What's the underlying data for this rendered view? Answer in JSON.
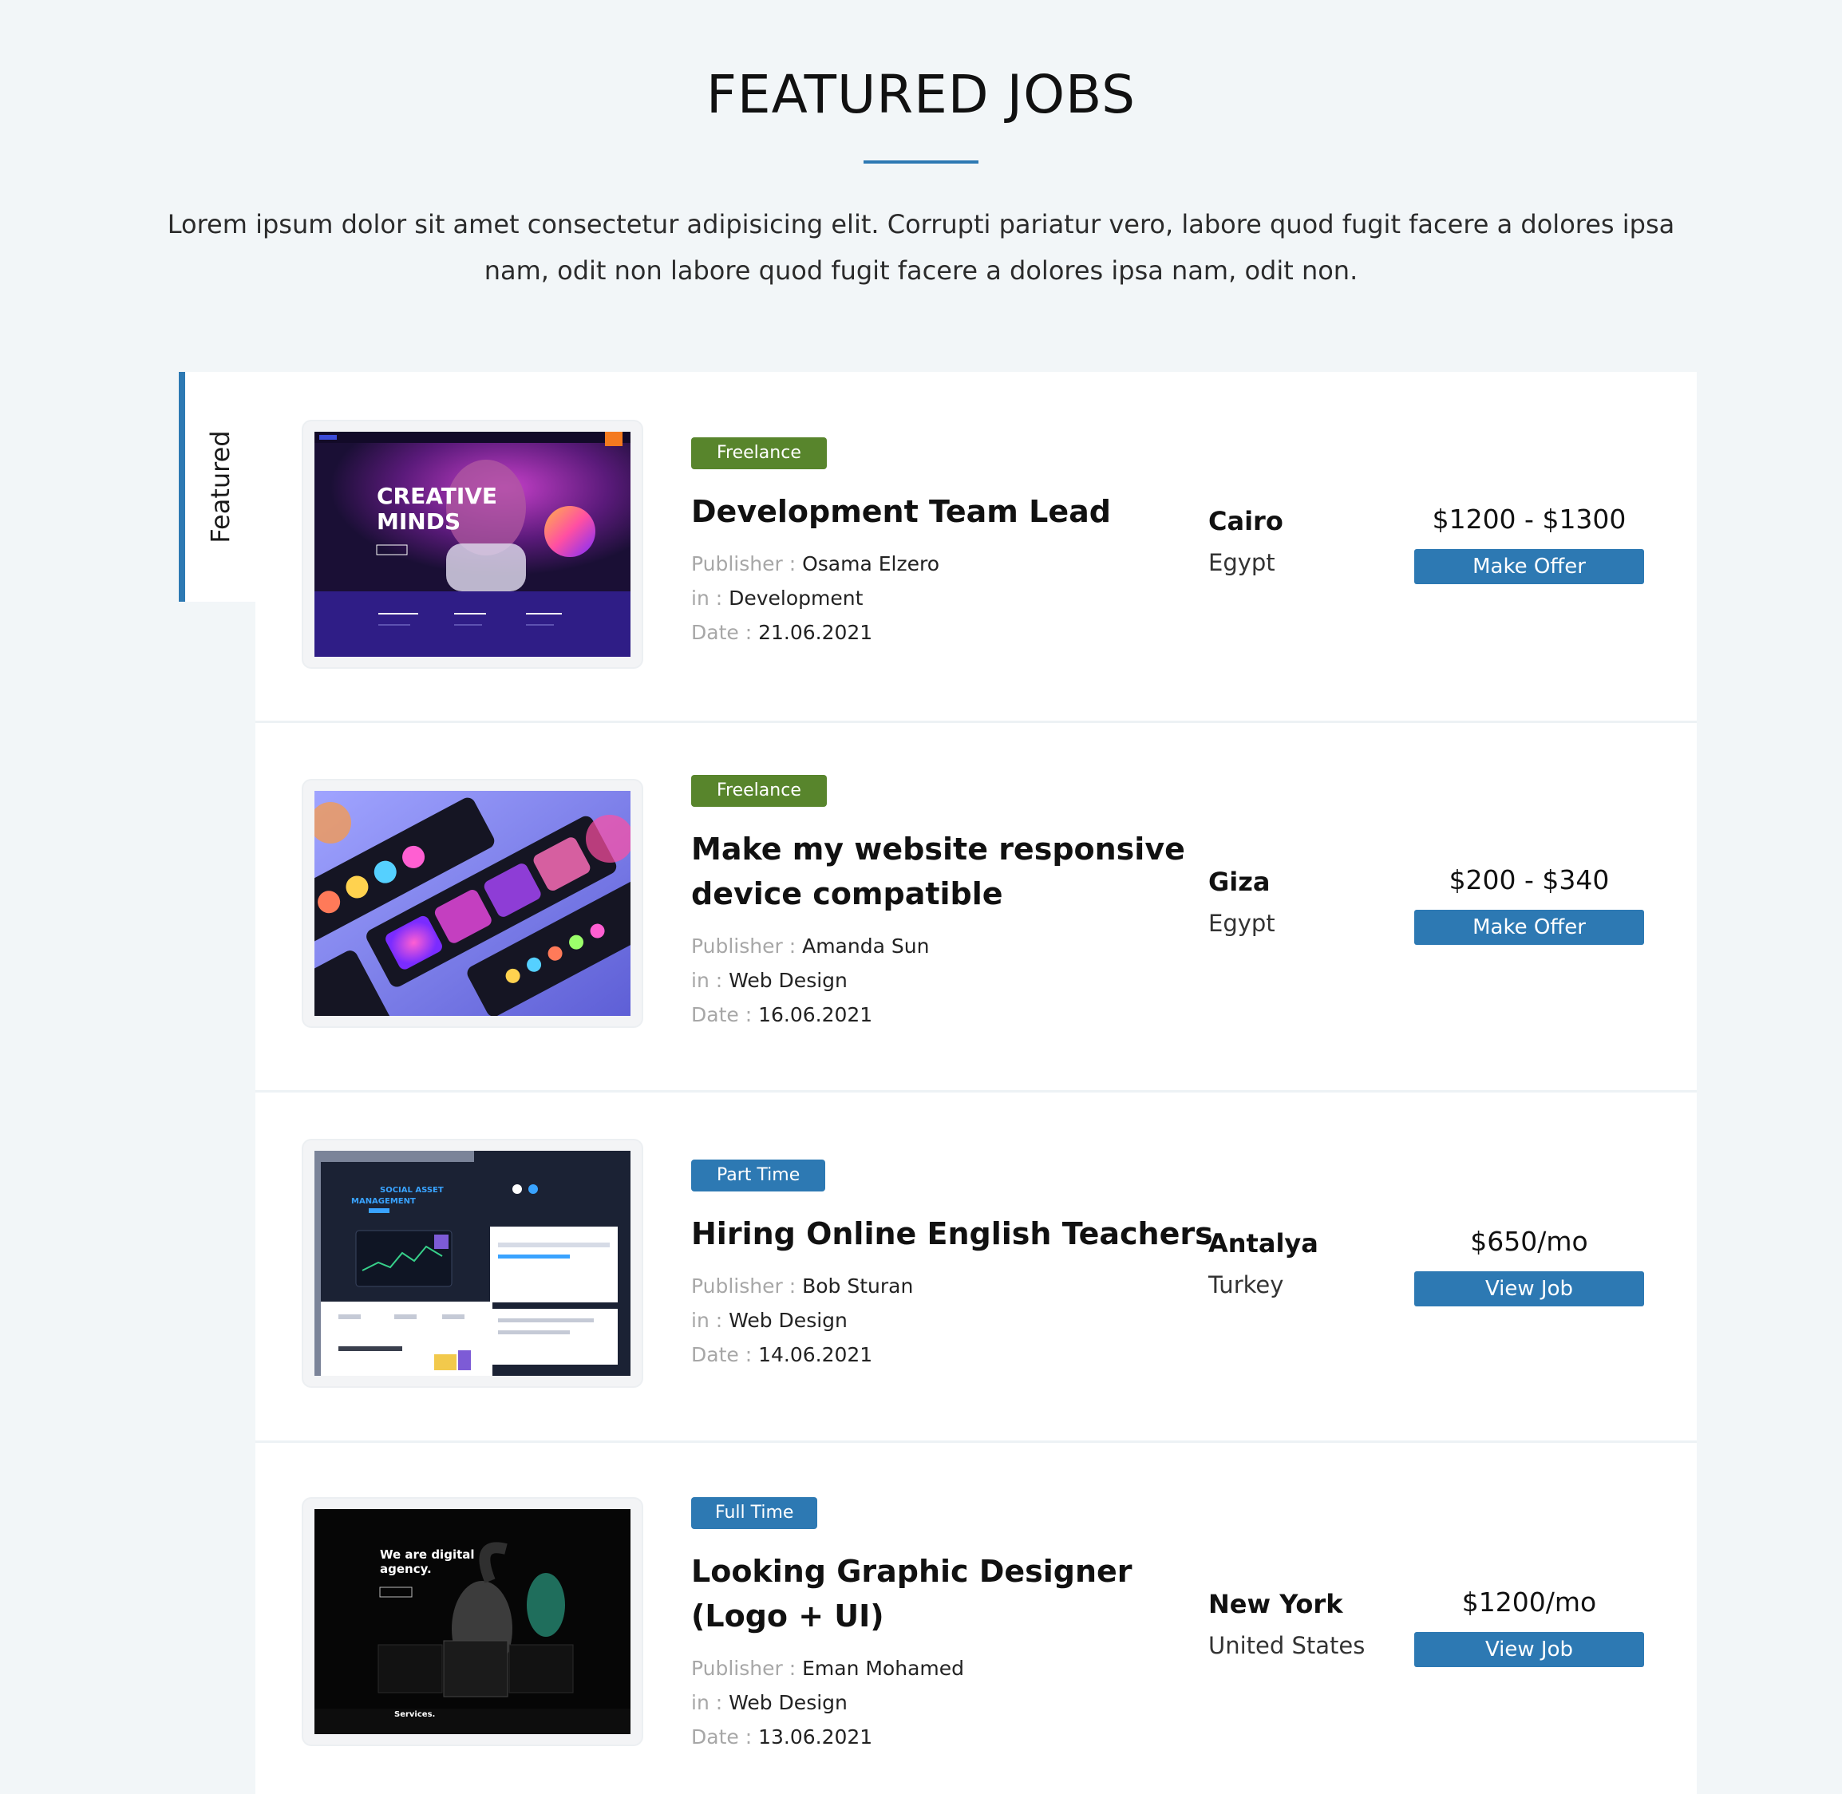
{
  "header": {
    "title": "FEATURED JOBS",
    "description": "Lorem ipsum dolor sit amet consectetur adipisicing elit. Corrupti pariatur vero, labore quod fugit facere a dolores ipsa nam, odit non labore quod fugit facere a dolores ipsa nam, odit non."
  },
  "ribbon": {
    "label": "Featured"
  },
  "labels": {
    "publisher": "Publisher : ",
    "category": "in : ",
    "date": "Date : "
  },
  "colors": {
    "accent": "#2d79b3",
    "badge_freelance": "#58852c",
    "page_background": "#f2f6f8"
  },
  "jobs": [
    {
      "badge": "Freelance",
      "title": "Development Team Lead",
      "publisher": "Osama Elzero",
      "category": "Development",
      "date": "21.06.2021",
      "city": "Cairo",
      "country": "Egypt",
      "price": "$1200 - $1300",
      "action": "Make Offer",
      "thumb_text_1": "CREATIVE",
      "thumb_text_2": "MINDS"
    },
    {
      "badge": "Freelance",
      "title": "Make my website responsive device compatible",
      "publisher": "Amanda Sun",
      "category": "Web Design",
      "date": "16.06.2021",
      "city": "Giza",
      "country": "Egypt",
      "price": "$200 - $340",
      "action": "Make Offer"
    },
    {
      "badge": "Part Time",
      "title": "Hiring Online English Teachers",
      "publisher": "Bob Sturan",
      "category": "Web Design",
      "date": "14.06.2021",
      "city": "Antalya",
      "country": "Turkey",
      "price": "$650/mo",
      "action": "View Job",
      "thumb_text_1": "SOCIAL ASSET",
      "thumb_text_2": "MANAGEMENT"
    },
    {
      "badge": "Full Time",
      "title": "Looking Graphic Designer (Logo + UI)",
      "publisher": "Eman Mohamed",
      "category": "Web Design",
      "date": "13.06.2021",
      "city": "New York",
      "country": "United States",
      "price": "$1200/mo",
      "action": "View Job",
      "thumb_text_1": "We are digital",
      "thumb_text_2": "agency.",
      "thumb_text_3": "Services."
    }
  ]
}
